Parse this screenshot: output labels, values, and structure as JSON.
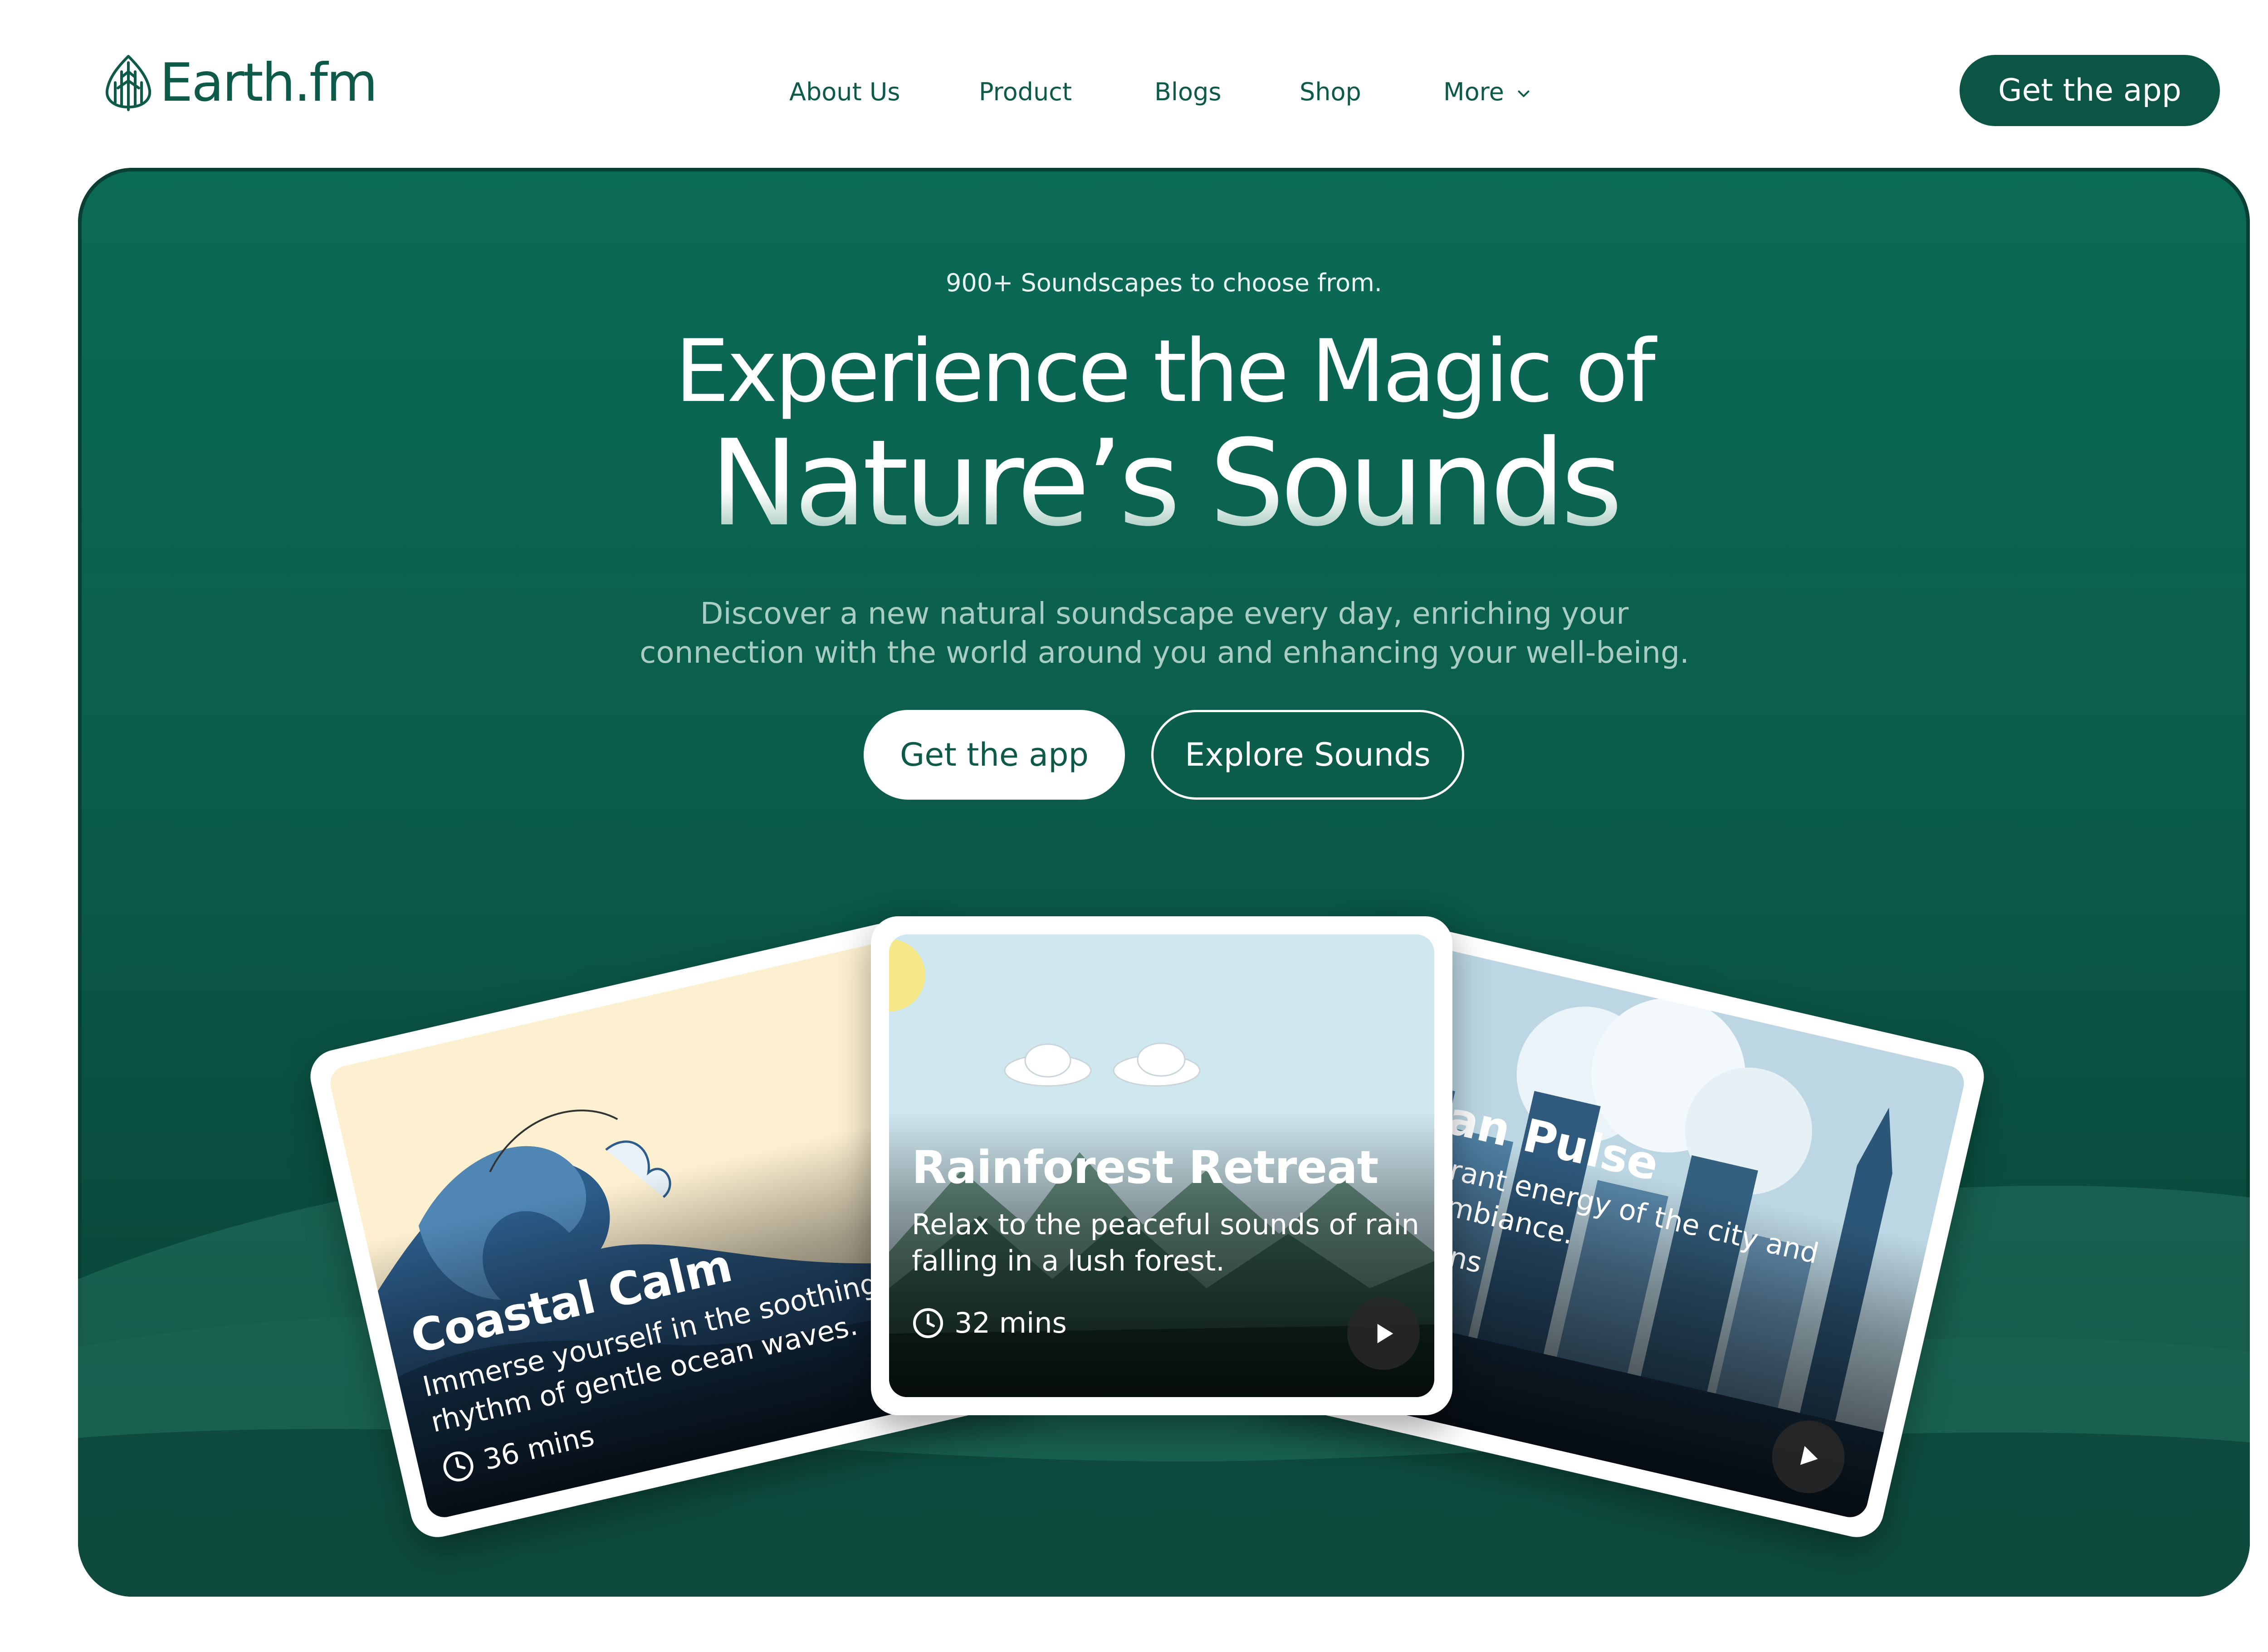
{
  "brand": {
    "name": "Earth.fm",
    "logo_icon": "tree-logo-icon"
  },
  "nav": {
    "items": [
      {
        "label": "About Us"
      },
      {
        "label": "Product"
      },
      {
        "label": "Blogs"
      },
      {
        "label": "Shop"
      },
      {
        "label": "More",
        "icon": "chevron-down-icon"
      }
    ],
    "cta_label": "Get the app"
  },
  "hero": {
    "tagline": "900+ Soundscapes to choose from.",
    "title_line1": "Experience the Magic of",
    "title_line2": "Nature’s Sounds",
    "subtitle": "Discover a new natural soundscape every day, enriching your connection with the world around you and enhancing your well-being.",
    "primary_button": "Get the app",
    "secondary_button": "Explore Sounds"
  },
  "cards": {
    "left": {
      "title": "Coastal Calm",
      "description": "Immerse yourself in the soothing rhythm of gentle ocean waves.",
      "duration": "36 mins"
    },
    "center": {
      "title": "Rainforest Retreat",
      "description": "Relax to the peaceful sounds of rain falling in a lush forest.",
      "duration": "32 mins"
    },
    "right": {
      "title": "Urban Pulse",
      "description": "The vibrant energy of the city and urban ambiance.",
      "duration": "28 mins"
    }
  },
  "colors": {
    "brand_green": "#0c5443",
    "hero_top": "#0a6b56",
    "hero_bottom": "#08392e",
    "text_light": "#a9cdc2"
  }
}
